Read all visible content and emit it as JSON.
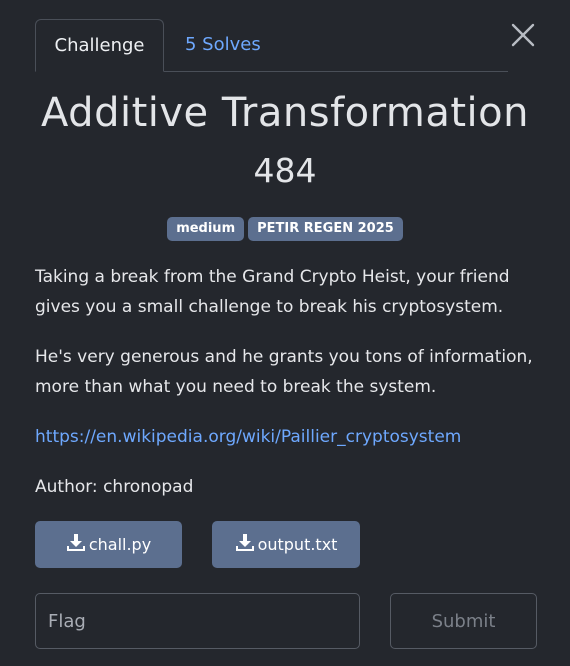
{
  "tabs": {
    "challenge_label": "Challenge",
    "solves_label": "5 Solves"
  },
  "challenge": {
    "title": "Additive Transformation",
    "points": "484",
    "tags": [
      "medium",
      "PETIR REGEN 2025"
    ],
    "description": [
      "Taking a break from the Grand Crypto Heist, your friend gives you a small challenge to break his cryptosystem.",
      "He's very generous and he grants you tons of information, more than what you need to break the system."
    ],
    "link_text": "https://en.wikipedia.org/wiki/Paillier_cryptosystem",
    "author": "Author: chronopad"
  },
  "files": [
    "chall.py",
    "output.txt"
  ],
  "form": {
    "flag_placeholder": "Flag",
    "flag_value": "",
    "submit_label": "Submit"
  },
  "icons": {
    "close": "close-icon",
    "download": "download-icon"
  },
  "colors": {
    "background": "#24272d",
    "accent_link": "#6ea8fe",
    "badge": "#5c6f8f"
  }
}
